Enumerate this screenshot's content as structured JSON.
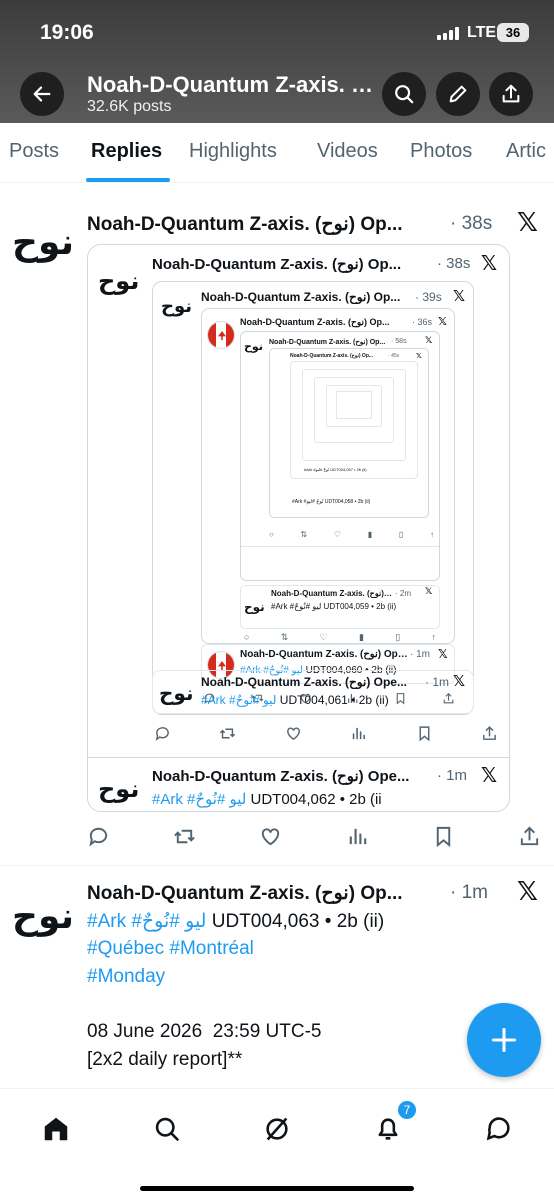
{
  "status_bar": {
    "time": "19:06",
    "network": "LTE",
    "battery": "36"
  },
  "header": {
    "title": "Noah-D-Quantum Z-axis. (نوح) Op",
    "posts_count": "32.6K posts",
    "icons": [
      "back-arrow-icon",
      "search-icon",
      "edit-icon",
      "share-icon"
    ]
  },
  "tabs": [
    "Posts",
    "Replies",
    "Highlights",
    "Videos",
    "Photos",
    "Artic"
  ],
  "active_tab": "Replies",
  "avatar_text": "نوح",
  "post1": {
    "name": "Noah-D-Quantum Z-axis. (نوح) Op...",
    "time": "38s",
    "quote1": {
      "name": "Noah-D-Quantum Z-axis. (نوح) Op...",
      "time": "38s"
    },
    "quote2": {
      "name": "Noah-D-Quantum Z-axis. (نوح) Op...",
      "time": "39s"
    },
    "quote3": {
      "name": "Noah-D-Quantum Z-axis. (نوح) Op...",
      "time": "36s"
    },
    "quote4": {
      "name": "Noah-D-Quantum Z-axis. (نوح) Op...",
      "time": "58s"
    },
    "quote5": {
      "name": "Noah-D-Quantum Z-axis. (نوح) Op...",
      "time": "45s"
    },
    "tiny_line1": "#Ark #نُوحٌ #ليو UDT004,057 • 2b (ii)",
    "tiny_line2": "#Ark #نُوحٌ #ليو UDT004,058 • 2b (ii)",
    "inner_post_a": {
      "name": "Noah-D-Quantum Z-axis. (نوح) O...",
      "time": "2m",
      "text": "#Ark #ليو #نُوحٌ UDT004,059 • 2b (ii)"
    },
    "inner_post_b": {
      "name": "Noah-D-Quantum Z-axis. (نوح) Ope...",
      "time": "1m",
      "hashtags": "#Ark #ليو #نُوحٌ",
      "text": " UDT004,060 • 2b (ii)"
    },
    "inner_post_c": {
      "name": "Noah-D-Quantum Z-axis. (نوح) Ope...",
      "time": "1m",
      "hashtags": "#Ark #ليو #نُوحٌ",
      "text": " UDT004,061 • 2b (ii)"
    },
    "inner_post_d": {
      "name": "Noah-D-Quantum Z-axis. (نوح) Ope...",
      "time": "1m",
      "hashtags": "#Ark #ليو #نُوحٌ",
      "text": " UDT004,062 • 2b (ii"
    }
  },
  "post2": {
    "name": "Noah-D-Quantum Z-axis. (نوح) Op...",
    "time": "1m",
    "hashtags": "#Ark #ليو #نُوحٌ",
    "text": " UDT004,063 • 2b (ii)",
    "line2": "#Québec #Montréal",
    "line3": "#Monday",
    "line4": "08 June 2026  23:59 UTC-5",
    "line5": "[2x2 daily report]**"
  },
  "bottom_nav": {
    "items": [
      "home-icon",
      "search-icon",
      "grok-icon",
      "notifications-icon",
      "messages-icon"
    ],
    "notification_count": "7"
  },
  "colors": {
    "accent": "#1d9bf0",
    "text": "#0f1419",
    "muted": "#536471",
    "border": "#cfd9de"
  }
}
